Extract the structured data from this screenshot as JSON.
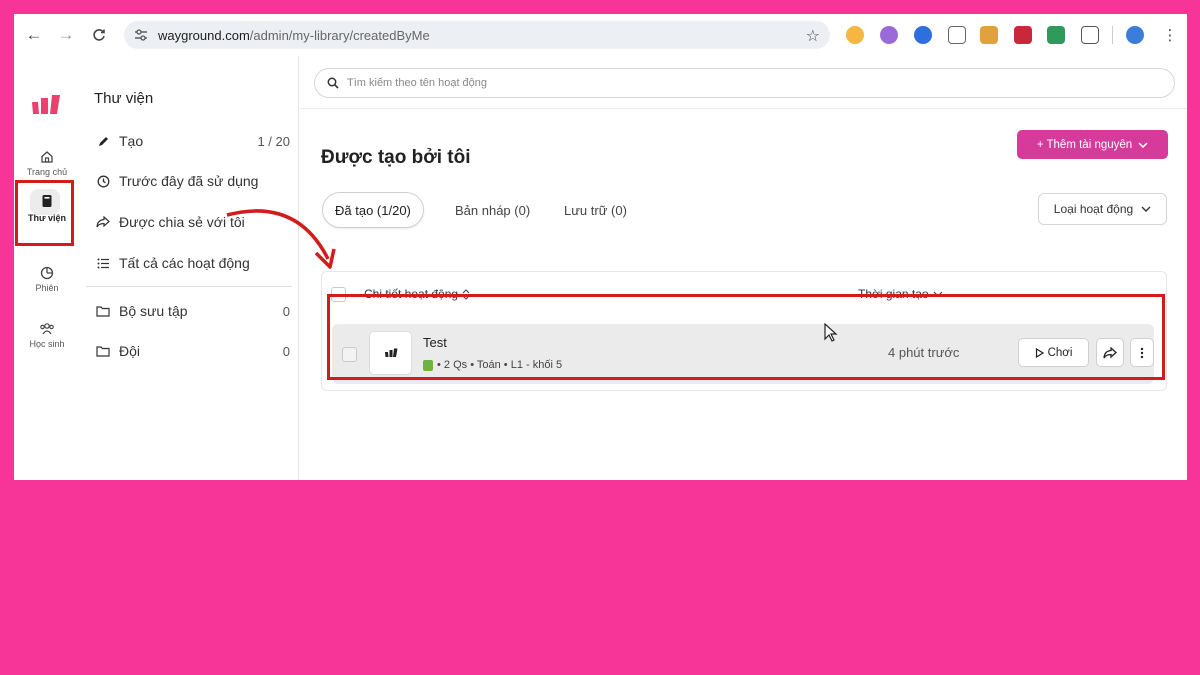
{
  "browser": {
    "url_host": "wayground.com",
    "url_path": "/admin/my-library/createdByMe"
  },
  "rail": {
    "items": [
      {
        "label": "Trang chủ"
      },
      {
        "label": "Thư viện"
      },
      {
        "label": "Phiên"
      },
      {
        "label": "Học sinh"
      }
    ]
  },
  "library": {
    "title": "Thư viện",
    "items": [
      {
        "label": "Tạo",
        "count": "1 / 20"
      },
      {
        "label": "Trước đây đã sử dụng"
      },
      {
        "label": "Được chia sẻ với tôi"
      },
      {
        "label": "Tất cả các hoạt động"
      },
      {
        "label": "Bộ sưu tập",
        "count": "0"
      },
      {
        "label": "Đội",
        "count": "0"
      }
    ]
  },
  "search": {
    "placeholder": "Tìm kiếm theo tên hoạt động"
  },
  "main": {
    "heading": "Được tạo bởi tôi",
    "add_button": "+ Thêm tài nguyên",
    "tabs": [
      {
        "label": "Đã tạo (1/20)"
      },
      {
        "label": "Bản nháp (0)"
      },
      {
        "label": "Lưu trữ (0)"
      }
    ],
    "type_filter": "Loại hoạt động"
  },
  "table": {
    "col_detail": "Chi tiết hoạt động",
    "col_time": "Thời gian tạo",
    "rows": [
      {
        "title": "Test",
        "meta": "• 2 Qs • Toán • L1 - khối 5",
        "created": "4 phút trước",
        "play_label": "Chơi"
      }
    ]
  },
  "colors": {
    "background": "#f73598",
    "accent_button": "#d63b9b",
    "highlight": "#d21b1b",
    "logo": "#e8436f"
  }
}
